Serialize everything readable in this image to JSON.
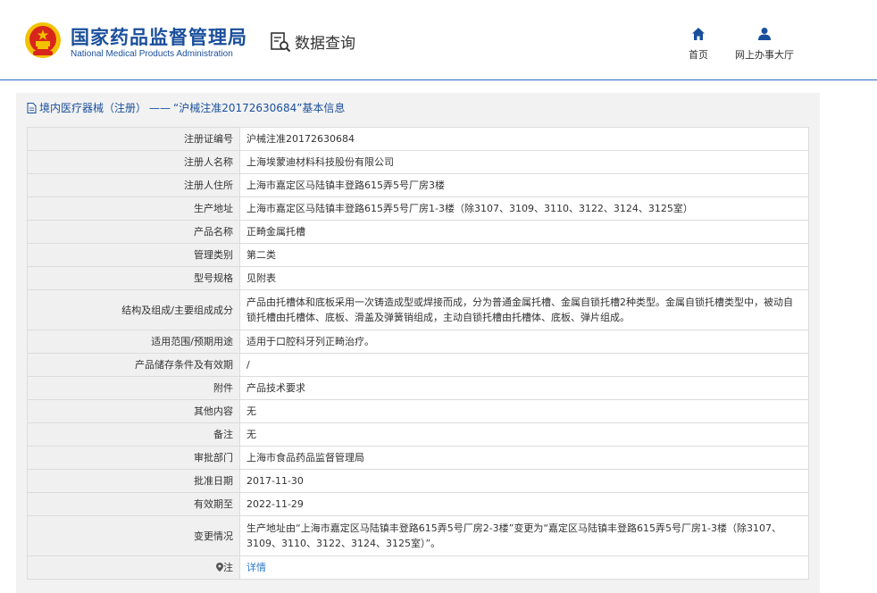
{
  "header": {
    "logo_cn": "国家药品监督管理局",
    "logo_en": "National Medical Products Administration",
    "search_label": "数据查询",
    "nav_home": "首页",
    "nav_hall": "网上办事大厅"
  },
  "panel": {
    "title_prefix": "境内医疗器械（注册）",
    "title_sep": "——",
    "title_main": "“沪械注准20172630684”基本信息"
  },
  "rows": [
    {
      "label": "注册证编号",
      "value": "沪械注准20172630684"
    },
    {
      "label": "注册人名称",
      "value": "上海埃蒙迪材料科技股份有限公司"
    },
    {
      "label": "注册人住所",
      "value": "上海市嘉定区马陆镇丰登路615弄5号厂房3楼"
    },
    {
      "label": "生产地址",
      "value": "上海市嘉定区马陆镇丰登路615弄5号厂房1-3楼（除3107、3109、3110、3122、3124、3125室）"
    },
    {
      "label": "产品名称",
      "value": "正畸金属托槽"
    },
    {
      "label": "管理类别",
      "value": "第二类"
    },
    {
      "label": "型号规格",
      "value": "见附表"
    },
    {
      "label": "结构及组成/主要组成成分",
      "value": "产品由托槽体和底板采用一次铸造成型或焊接而成，分为普通金属托槽、金属自锁托槽2种类型。金属自锁托槽类型中，被动自锁托槽由托槽体、底板、滑盖及弹簧销组成，主动自锁托槽由托槽体、底板、弹片组成。"
    },
    {
      "label": "适用范围/预期用途",
      "value": "适用于口腔科牙列正畸治疗。"
    },
    {
      "label": "产品储存条件及有效期",
      "value": "/"
    },
    {
      "label": "附件",
      "value": "产品技术要求"
    },
    {
      "label": "其他内容",
      "value": "无"
    },
    {
      "label": "备注",
      "value": "无"
    },
    {
      "label": "审批部门",
      "value": "上海市食品药品监督管理局"
    },
    {
      "label": "批准日期",
      "value": "2017-11-30"
    },
    {
      "label": "有效期至",
      "value": "2022-11-29"
    },
    {
      "label": "变更情况",
      "value": "生产地址由“上海市嘉定区马陆镇丰登路615弄5号厂房2-3楼”变更为“嘉定区马陆镇丰登路615弄5号厂房1-3楼（除3107、3109、3110、3122、3124、3125室）”。"
    }
  ],
  "note": {
    "label": "注",
    "link": "详情"
  },
  "colors": {
    "brand_blue": "#1a4f9c",
    "link_blue": "#2b78c5",
    "emblem_red": "#d8261c",
    "emblem_gold": "#f2c200"
  }
}
